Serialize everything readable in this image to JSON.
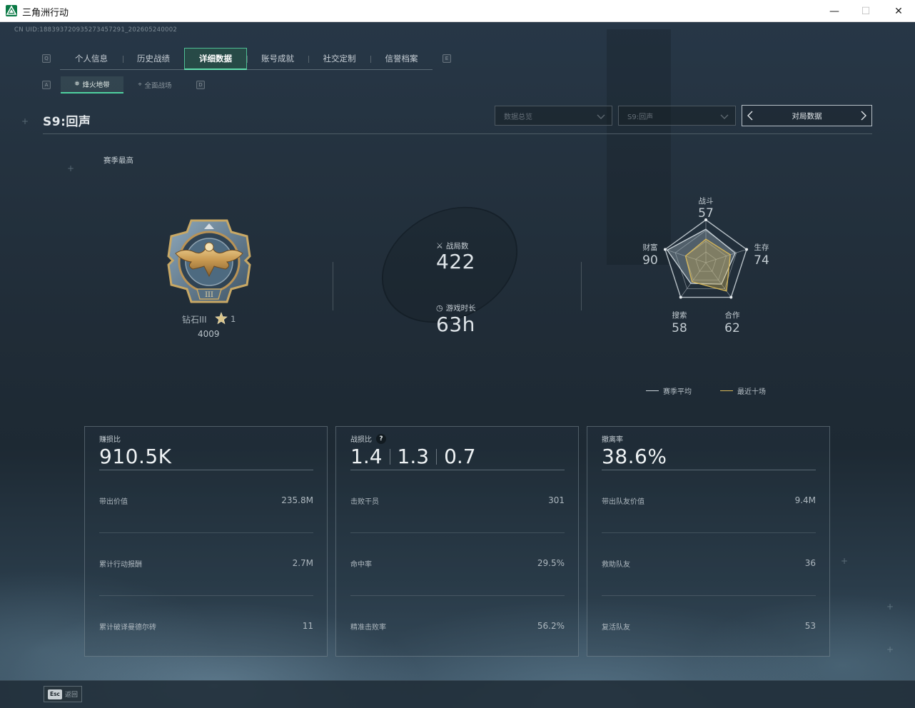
{
  "window": {
    "title": "三角洲行动",
    "minimize_glyph": "—",
    "maximize_glyph": "☐",
    "close_glyph": "✕"
  },
  "uid": "CN UID:1883937209352734572​91_202605240002",
  "key_hints": {
    "prev_tab": "Q",
    "next_tab": "E",
    "prev_sub": "A",
    "next_sub": "D"
  },
  "tabs": [
    {
      "label": "个人信息",
      "active": false
    },
    {
      "label": "历史战绩",
      "active": false
    },
    {
      "label": "详细数据",
      "active": true
    },
    {
      "label": "账号成就",
      "active": false
    },
    {
      "label": "社交定制",
      "active": false
    },
    {
      "label": "信誉档案",
      "active": false
    }
  ],
  "subtabs": [
    {
      "label": "烽火地带",
      "active": true
    },
    {
      "label": "全面战场",
      "active": false
    }
  ],
  "season_title": "S9:回声",
  "filters": {
    "data_type": "数据总览",
    "season": "S9:回声",
    "match_nav": "对局数据"
  },
  "rank": {
    "section_label": "赛季最高",
    "name": "钻石III",
    "stars": "1",
    "score": "4009"
  },
  "summary": {
    "matches_label": "战局数",
    "matches_value": "422",
    "playtime_label": "游戏时长",
    "playtime_value": "63h"
  },
  "radar": {
    "axes": [
      {
        "label": "战斗",
        "value": "57"
      },
      {
        "label": "生存",
        "value": "74"
      },
      {
        "label": "合作",
        "value": "62"
      },
      {
        "label": "搜索",
        "value": "58"
      },
      {
        "label": "财富",
        "value": "90"
      }
    ],
    "season_avg_levels": [
      0.78,
      0.72,
      0.62,
      0.6,
      0.95
    ],
    "recent_ten_levels": [
      0.55,
      0.6,
      0.82,
      0.55,
      0.5
    ],
    "legend_season_avg": "赛季平均",
    "legend_recent_ten": "最近十场",
    "colors": {
      "season_avg": "#c9d2d8",
      "recent_ten": "#d8b859"
    }
  },
  "cards": {
    "profit": {
      "title": "赚损比",
      "main": "910.5K",
      "rows": [
        {
          "label": "带出价值",
          "value": "235.8M"
        },
        {
          "label": "累计行动报酬",
          "value": "2.7M"
        },
        {
          "label": "累计破译曼德尔砖",
          "value": "11"
        }
      ]
    },
    "kd": {
      "title": "战损比",
      "help": "?",
      "mains": [
        "1.4",
        "1.3",
        "0.7"
      ],
      "rows": [
        {
          "label": "击败干员",
          "value": "301"
        },
        {
          "label": "命中率",
          "value": "29.5%"
        },
        {
          "label": "精准击败率",
          "value": "56.2%"
        }
      ]
    },
    "extract": {
      "title": "撤离率",
      "main": "38.6%",
      "rows": [
        {
          "label": "带出队友价值",
          "value": "9.4M"
        },
        {
          "label": "救助队友",
          "value": "36"
        },
        {
          "label": "复活队友",
          "value": "53"
        }
      ]
    }
  },
  "bottom": {
    "esc_key": "Esc",
    "esc_label": "返回"
  },
  "accent_color": "#4fd19f"
}
